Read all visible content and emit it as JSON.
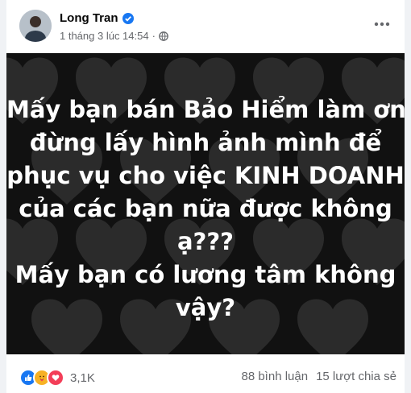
{
  "post": {
    "author": "Long Tran",
    "timestamp": "1 tháng 3 lúc 14:54",
    "separator": "·",
    "privacy_icon": "globe-icon",
    "verified_icon": "verified-badge-icon",
    "more_icon": "more-options-icon",
    "image_text_lines": [
      "Mấy bạn bán Bảo Hiểm làm ơn",
      "đừng lấy hình ảnh mình để",
      "phục vụ cho việc KINH DOANH",
      "của các bạn nữa được không",
      "ạ???",
      "Mấy bạn có lương tâm không",
      "vậy?"
    ]
  },
  "engagement": {
    "reaction_icons": [
      "like-icon",
      "care-icon",
      "love-icon"
    ],
    "reaction_count": "3,1K",
    "comments": "88 bình luận",
    "shares": "15 lượt chia sẻ"
  },
  "colors": {
    "accent": "#1877f2",
    "like": "#1877f2",
    "love": "#f33e58",
    "care": "#f7b125",
    "image_bg": "#111111",
    "heart": "#2b2b2b"
  }
}
